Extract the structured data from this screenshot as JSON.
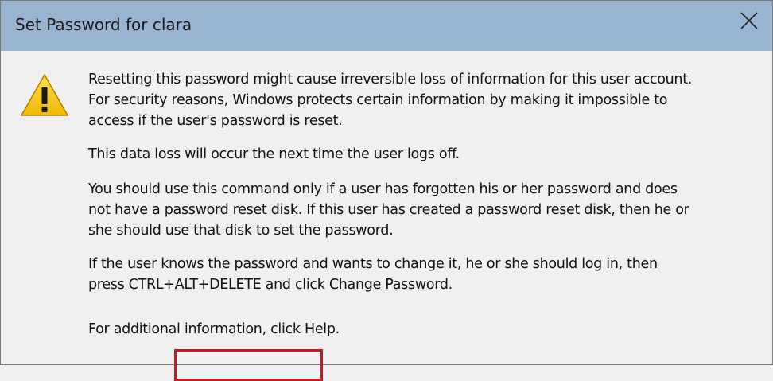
{
  "window": {
    "title": "Set Password for clara",
    "close_icon": "close-icon"
  },
  "icon": "warning-icon",
  "colors": {
    "titlebar": "#99b4d1",
    "dialog_bg": "#f0f0f0",
    "highlight": "#c8191e",
    "warning_yellow": "#f7c30a"
  },
  "message": {
    "p1": [
      "Resetting this password might cause irreversible loss of information for this user account.",
      "For security reasons, Windows protects certain information by making it impossible to",
      "access if the user's password is reset."
    ],
    "p2": [
      "This data loss will occur the next time the user logs off."
    ],
    "p3": [
      "You should use this command only if a user has forgotten his or her password and does",
      "not have a password reset disk. If this user has created a password reset disk, then he or",
      "she should use that disk to set the password."
    ],
    "p4": [
      "If the user knows the password and wants to change it, he or she should log in, then",
      "press CTRL+ALT+DELETE and click Change Password."
    ],
    "p5": [
      "For additional information, click Help."
    ]
  }
}
